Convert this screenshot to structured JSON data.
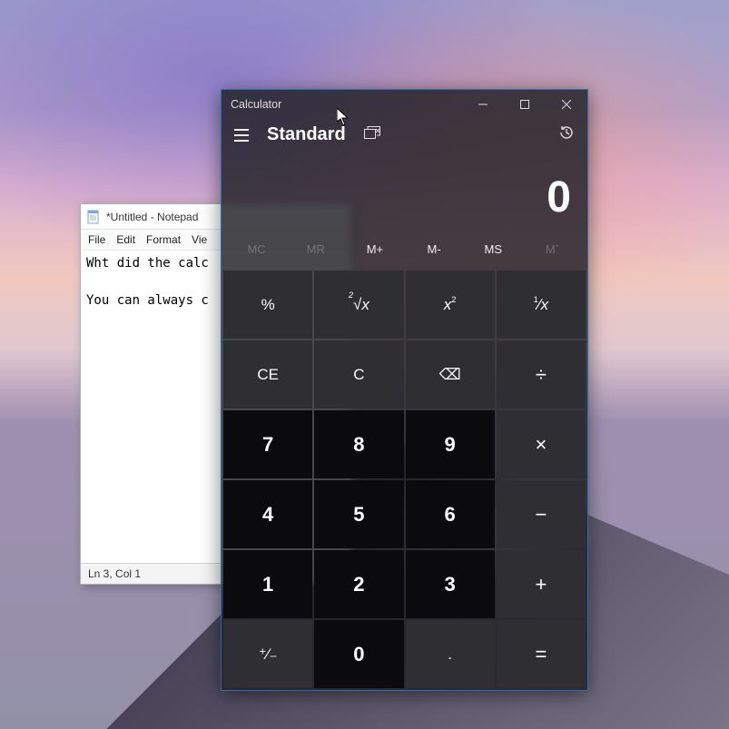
{
  "notepad": {
    "title": "*Untitled - Notepad",
    "menu": {
      "file": "File",
      "edit": "Edit",
      "format": "Format",
      "view": "Vie"
    },
    "body_line1": "Wht did the calc",
    "body_line2": "",
    "body_line3": "You can always c",
    "status": "Ln 3, Col 1"
  },
  "calculator": {
    "title": "Calculator",
    "mode": "Standard",
    "display": "0",
    "memory": {
      "mc": "MC",
      "mr": "MR",
      "mplus": "M+",
      "mminus": "M-",
      "ms": "MS",
      "mlist": "Mˇ"
    },
    "keys": {
      "percent": "%",
      "root": "²√x",
      "square": "x²",
      "recip": "¹⁄x",
      "ce": "CE",
      "c": "C",
      "back": "⌫",
      "div": "÷",
      "mul": "×",
      "sub": "−",
      "add": "+",
      "eq": "=",
      "sign": "⁺⁄₋",
      "dot": ".",
      "n0": "0",
      "n1": "1",
      "n2": "2",
      "n3": "3",
      "n4": "4",
      "n5": "5",
      "n6": "6",
      "n7": "7",
      "n8": "8",
      "n9": "9"
    }
  }
}
